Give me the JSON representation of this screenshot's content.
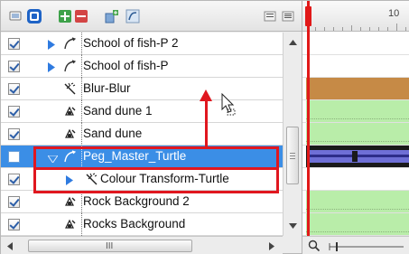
{
  "toolbar": {
    "buttons": [
      {
        "name": "display-icon"
      },
      {
        "name": "show-all-icon"
      },
      {
        "name": "add-layer-icon"
      },
      {
        "name": "remove-layer-icon"
      },
      {
        "name": "add-peg-icon"
      },
      {
        "name": "layer-properties-icon"
      },
      {
        "name": "collapse-icon"
      },
      {
        "name": "menu-icon"
      }
    ]
  },
  "layers": [
    {
      "name": "School of fish-P 2",
      "checked": true,
      "icon": "peg-icon",
      "expander": "collapsed",
      "selected": false
    },
    {
      "name": "School of fish-P",
      "checked": true,
      "icon": "peg-icon",
      "expander": "collapsed",
      "selected": false
    },
    {
      "name": "Blur-Blur",
      "checked": true,
      "icon": "effect-icon",
      "expander": "none",
      "selected": false
    },
    {
      "name": "Sand dune 1",
      "checked": true,
      "icon": "drawing-icon",
      "expander": "none",
      "selected": false
    },
    {
      "name": "Sand dune",
      "checked": true,
      "icon": "drawing-icon",
      "expander": "none",
      "selected": false
    },
    {
      "name": "Peg_Master_Turtle",
      "checked": false,
      "icon": "peg-icon",
      "expander": "expanded",
      "selected": true
    },
    {
      "name": "Colour Transform-Turtle",
      "checked": true,
      "icon": "effect-icon",
      "expander": "collapsed",
      "selected": false
    },
    {
      "name": "Rock Background 2",
      "checked": true,
      "icon": "drawing-icon",
      "expander": "none",
      "selected": false
    },
    {
      "name": "Rocks Background",
      "checked": true,
      "icon": "drawing-icon",
      "expander": "none",
      "selected": false
    }
  ],
  "timeline": {
    "ruler_label": "10",
    "tracks": [
      "white",
      "white",
      "orange",
      "green",
      "green",
      "dark",
      "white",
      "green",
      "green"
    ]
  },
  "colors": {
    "selection": "#3b8ee6",
    "highlight": "#e0171f",
    "track_green": "#b9eda9",
    "track_orange": "#c68a46",
    "playhead": "#e11919"
  },
  "scrollbar": {
    "grip_label": "III"
  }
}
